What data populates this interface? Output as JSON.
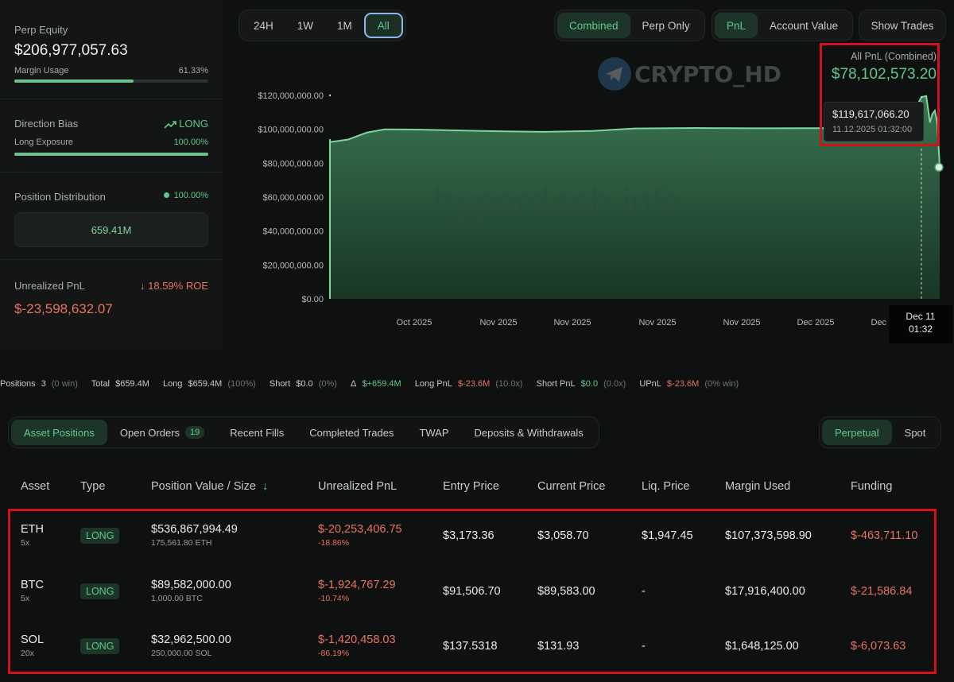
{
  "left_panel": {
    "perp_equity_label": "Perp Equity",
    "perp_equity_value": "$206,977,057.63",
    "margin_usage_label": "Margin Usage",
    "margin_usage_value": "61.33%",
    "margin_usage_fraction": 0.6133,
    "direction_bias_label": "Direction Bias",
    "direction_bias_value": "LONG",
    "long_exposure_label": "Long Exposure",
    "long_exposure_value": "100.00%",
    "long_exposure_fraction": 1.0,
    "position_distribution_label": "Position Distribution",
    "position_distribution_pct": "100.00%",
    "position_distribution_value": "659.41M",
    "unrealized_pnl_label": "Unrealized PnL",
    "unrealized_pnl_roe": "18.59% ROE",
    "unrealized_pnl_value": "$-23,598,632.07"
  },
  "timeframes": [
    "24H",
    "1W",
    "1M",
    "All"
  ],
  "timeframe_selected": "All",
  "view_modes": [
    "Combined",
    "Perp Only"
  ],
  "view_selected": "Combined",
  "metric_modes": [
    "PnL",
    "Account Value"
  ],
  "metric_selected": "PnL",
  "show_trades_label": "Show Trades",
  "pnl_header": {
    "label": "All PnL (Combined)",
    "value": "$78,102,573.20"
  },
  "tooltip": {
    "value": "$119,617,066.20",
    "datetime": "11.12.2025 01:32:00"
  },
  "crosshair_label": {
    "line1": "Dec 11",
    "line2": "01:32"
  },
  "watermarks": {
    "channel": "CRYPTO_HD",
    "site": "hyperdash.info"
  },
  "chart_data": {
    "type": "area",
    "y_ticks": [
      "$120,000,000.00",
      "$100,000,000.00",
      "$80,000,000.00",
      "$60,000,000.00",
      "$40,000,000.00",
      "$20,000,000.00",
      "$0.00"
    ],
    "x_ticks": [
      "Oct 2025",
      "Nov 2025",
      "Nov 2025",
      "Nov 2025",
      "Nov 2025",
      "Dec 2025",
      "Dec 2025"
    ],
    "ylim": [
      0,
      120000000
    ],
    "points": [
      [
        0.0,
        92500000
      ],
      [
        0.03,
        94000000
      ],
      [
        0.06,
        98000000
      ],
      [
        0.09,
        100000000
      ],
      [
        0.15,
        99800000
      ],
      [
        0.25,
        99000000
      ],
      [
        0.35,
        98500000
      ],
      [
        0.43,
        99000000
      ],
      [
        0.5,
        100500000
      ],
      [
        0.6,
        100800000
      ],
      [
        0.7,
        100600000
      ],
      [
        0.8,
        100700000
      ],
      [
        0.88,
        100800000
      ],
      [
        0.93,
        101000000
      ],
      [
        0.952,
        103000000
      ],
      [
        0.96,
        112000000
      ],
      [
        0.97,
        119000000
      ],
      [
        0.978,
        119617066
      ],
      [
        0.984,
        104000000
      ],
      [
        0.988,
        109000000
      ],
      [
        0.992,
        111000000
      ],
      [
        0.996,
        104000000
      ],
      [
        1.0,
        78102573
      ]
    ]
  },
  "summary": {
    "positions_label": "Positions",
    "positions_value": "3",
    "positions_win": "(0 win)",
    "total_label": "Total",
    "total_value": "$659.4M",
    "long_label": "Long",
    "long_value": "$659.4M",
    "long_pct": "(100%)",
    "short_label": "Short",
    "short_value": "$0.0",
    "short_pct": "(0%)",
    "delta_label": "Δ",
    "delta_value": "$+659.4M",
    "long_pnl_label": "Long PnL",
    "long_pnl_value": "$-23.6M",
    "long_pnl_lev": "(10.0x)",
    "short_pnl_label": "Short PnL",
    "short_pnl_value": "$0.0",
    "short_pnl_lev": "(0.0x)",
    "upnl_label": "UPnL",
    "upnl_value": "$-23.6M",
    "upnl_win": "(0% win)"
  },
  "tabs": [
    "Asset Positions",
    "Open Orders",
    "Recent Fills",
    "Completed Trades",
    "TWAP",
    "Deposits & Withdrawals"
  ],
  "open_orders_count": "19",
  "market_tabs": [
    "Perpetual",
    "Spot"
  ],
  "table": {
    "headers": [
      "Asset",
      "Type",
      "Position Value / Size",
      "Unrealized PnL",
      "Entry Price",
      "Current Price",
      "Liq. Price",
      "Margin Used",
      "Funding"
    ],
    "sort_arrow": "↓",
    "rows": [
      {
        "asset": "ETH",
        "leverage": "5x",
        "type": "LONG",
        "value": "$536,867,994.49",
        "size": "175,561.80 ETH",
        "upnl": "$-20,253,406.75",
        "upnl_pct": "-18.86%",
        "entry": "$3,173.36",
        "current": "$3,058.70",
        "liq": "$1,947.45",
        "margin": "$107,373,598.90",
        "funding": "$-463,711.10"
      },
      {
        "asset": "BTC",
        "leverage": "5x",
        "type": "LONG",
        "value": "$89,582,000.00",
        "size": "1,000.00 BTC",
        "upnl": "$-1,924,767.29",
        "upnl_pct": "-10.74%",
        "entry": "$91,506.70",
        "current": "$89,583.00",
        "liq": "-",
        "margin": "$17,916,400.00",
        "funding": "$-21,586.84"
      },
      {
        "asset": "SOL",
        "leverage": "20x",
        "type": "LONG",
        "value": "$32,962,500.00",
        "size": "250,000.00 SOL",
        "upnl": "$-1,420,458.03",
        "upnl_pct": "-86.19%",
        "entry": "$137.5318",
        "current": "$131.93",
        "liq": "-",
        "margin": "$1,648,125.00",
        "funding": "$-6,073.63"
      }
    ]
  },
  "colors": {
    "accent_green": "#5fc98b",
    "negative_red": "#e8735f",
    "highlight_red": "#d2121a"
  }
}
